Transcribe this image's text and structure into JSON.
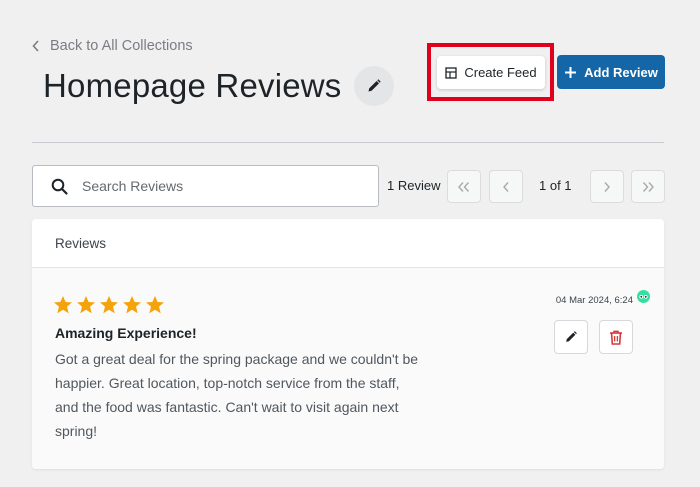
{
  "header": {
    "back_label": "Back to All Collections",
    "title": "Homepage Reviews",
    "create_feed_label": "Create Feed",
    "add_review_label": "Add Review"
  },
  "toolbar": {
    "search_placeholder": "Search Reviews",
    "count_label": "1 Review",
    "page_indicator": "1 of 1"
  },
  "reviews_panel": {
    "heading": "Reviews",
    "items": [
      {
        "rating": 5,
        "title": "Amazing Experience!",
        "body": "Got a great deal for the spring package and we couldn't be happier. Great location, top-notch service from the staff, and the food was fantastic. Can't wait to visit again next spring!",
        "date": "04 Mar 2024, 6:24",
        "source_icon": "tripadvisor-icon"
      }
    ]
  },
  "colors": {
    "accent": "#1466a6",
    "highlight": "#e0001b",
    "star": "#f5a30a",
    "delete": "#d63638",
    "source": "#34e0a1"
  }
}
